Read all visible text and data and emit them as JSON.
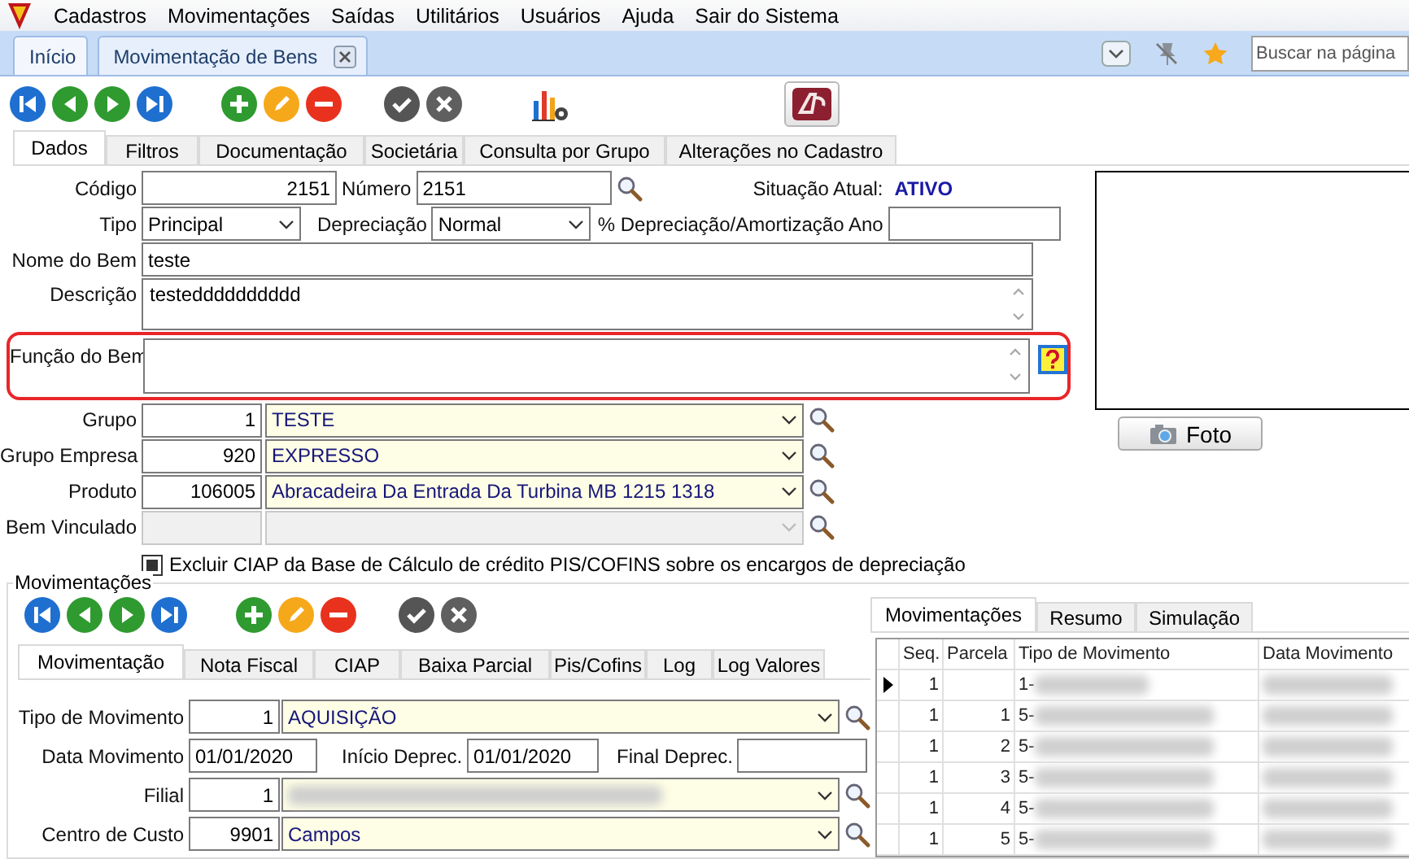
{
  "menu": [
    {
      "label": "Cadastros"
    },
    {
      "label": "Movimentações"
    },
    {
      "label": "Saídas"
    },
    {
      "label": "Utilitários"
    },
    {
      "label": "Usuários"
    },
    {
      "label": "Ajuda"
    },
    {
      "label": "Sair do Sistema"
    }
  ],
  "page_tabs": [
    {
      "label": "Início",
      "selected": false,
      "closable": false
    },
    {
      "label": "Movimentação de Bens",
      "selected": true,
      "closable": true
    }
  ],
  "search": {
    "placeholder": "Buscar na página"
  },
  "main_tabs": [
    {
      "label": "Dados",
      "selected": true
    },
    {
      "label": "Filtros",
      "selected": false
    },
    {
      "label": "Documentação",
      "selected": false
    },
    {
      "label": "Societária",
      "selected": false
    },
    {
      "label": "Consulta por Grupo",
      "selected": false
    },
    {
      "label": "Alterações no Cadastro",
      "selected": false
    }
  ],
  "form": {
    "codigo": {
      "label": "Código",
      "value": "2151"
    },
    "numero": {
      "label": "Número",
      "value": "2151"
    },
    "situacao": {
      "label": "Situação Atual:",
      "value": "ATIVO"
    },
    "tipo": {
      "label": "Tipo",
      "value": "Principal"
    },
    "depreciacao": {
      "label": "Depreciação",
      "value": "Normal"
    },
    "percentual": {
      "label": "% Depreciação/Amortização Ano"
    },
    "nome": {
      "label": "Nome do Bem",
      "value": "teste"
    },
    "descricao": {
      "label": "Descrição",
      "value": "testedddddddddd"
    },
    "funcao": {
      "label": "Função do Bem",
      "highlighted": true
    },
    "lookups": [
      {
        "label": "Grupo",
        "code": "1",
        "value": "TESTE",
        "disabled": false
      },
      {
        "label": "Grupo Empresa",
        "code": "920",
        "value": "EXPRESSO",
        "disabled": false
      },
      {
        "label": "Produto",
        "code": "106005",
        "value": "Abracadeira Da Entrada Da Turbina MB 1215 1318",
        "disabled": false
      },
      {
        "label": "Bem Vinculado",
        "disabled": true
      }
    ],
    "checkbox": {
      "label": "Excluir CIAP da Base de Cálculo de crédito PIS/COFINS sobre os encargos de depreciação",
      "checked": true
    },
    "photo_button": "Foto"
  },
  "movimentacoes": {
    "title": "Movimentações",
    "tabs": [
      {
        "label": "Movimentação",
        "selected": true
      },
      {
        "label": "Nota Fiscal",
        "selected": false
      },
      {
        "label": "CIAP",
        "selected": false
      },
      {
        "label": "Baixa Parcial",
        "selected": false
      },
      {
        "label": "Pis/Cofins",
        "selected": false
      },
      {
        "label": "Log",
        "selected": false
      },
      {
        "label": "Log Valores",
        "selected": false
      }
    ],
    "tipo": {
      "label": "Tipo de Movimento",
      "code": "1",
      "value": "AQUISIÇÃO"
    },
    "data": {
      "label": "Data Movimento",
      "value": "01/01/2020"
    },
    "inicio": {
      "label": "Início Deprec.",
      "value": "01/01/2020"
    },
    "final": {
      "label": "Final Deprec."
    },
    "filial": {
      "label": "Filial",
      "code": "1",
      "redacted": true
    },
    "centro": {
      "label": "Centro de Custo",
      "code": "9901",
      "value": "Campos"
    },
    "side_tabs": [
      {
        "label": "Movimentações",
        "selected": true
      },
      {
        "label": "Resumo",
        "selected": false
      },
      {
        "label": "Simulação",
        "selected": false
      }
    ],
    "grid": {
      "columns": [
        "Seq.",
        "Parcela",
        "Tipo de Movimento",
        "Data Movimento"
      ],
      "rows": [
        {
          "seq": "1",
          "tipo": "1-",
          "current": true
        },
        {
          "seq": "1",
          "parcela": "1",
          "tipo": "5-",
          "current": false
        },
        {
          "seq": "1",
          "parcela": "2",
          "tipo": "5-",
          "current": false
        },
        {
          "seq": "1",
          "parcela": "3",
          "tipo": "5-",
          "current": false
        },
        {
          "seq": "1",
          "parcela": "4",
          "tipo": "5-",
          "current": false
        },
        {
          "seq": "1",
          "parcela": "5",
          "tipo": "5-",
          "current": false
        }
      ]
    }
  }
}
